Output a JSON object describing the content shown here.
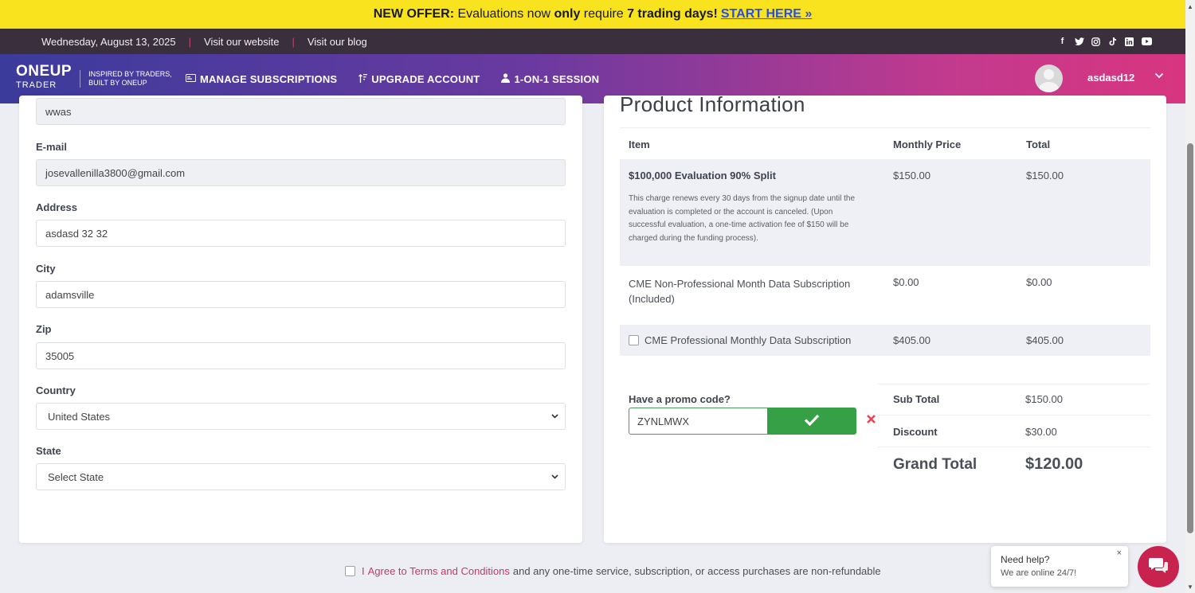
{
  "promo_banner": {
    "offer_label": "NEW OFFER:",
    "text_a": " Evaluations now ",
    "text_only": "only",
    "text_b": " require ",
    "text_days": "7 trading days!",
    "cta": "START HERE »"
  },
  "topbar": {
    "date": "Wednesday, August 13, 2025",
    "links": [
      "Visit our website",
      "Visit our blog"
    ],
    "socials": [
      "facebook-icon",
      "twitter-icon",
      "instagram-icon",
      "tiktok-icon",
      "linkedin-icon",
      "youtube-icon"
    ]
  },
  "nav": {
    "logo_main": "ONEUP",
    "logo_sub": "TRADER",
    "tagline_1": "INSPIRED BY TRADERS,",
    "tagline_2": "BUILT BY ONEUP",
    "items": [
      {
        "label": "MANAGE SUBSCRIPTIONS",
        "icon": "card-icon"
      },
      {
        "label": "UPGRADE ACCOUNT",
        "icon": "upgrade-icon"
      },
      {
        "label": "1-ON-1 SESSION",
        "icon": "session-icon"
      }
    ],
    "username": "asdasd12"
  },
  "form": {
    "name_value": "wwas",
    "email_label": "E-mail",
    "email_value": "josevallenilla3800@gmail.com",
    "address_label": "Address",
    "address_value": "asdasd 32 32",
    "city_label": "City",
    "city_value": "adamsville",
    "zip_label": "Zip",
    "zip_value": "35005",
    "country_label": "Country",
    "country_value": "United States",
    "state_label": "State",
    "state_value": "Select State"
  },
  "product": {
    "title": "Product Information",
    "columns": [
      "Item",
      "Monthly Price",
      "Total"
    ],
    "rows": [
      {
        "item": "$100,000 Evaluation 90% Split",
        "note": "This charge renews every 30 days from the signup date until the evaluation is completed or the account is canceled. (Upon successful evaluation, a one-time activation fee of $150 will be charged during the funding process).",
        "price": "$150.00",
        "total": "$150.00"
      },
      {
        "item": "CME Non-Professional Month Data Subscription (Included)",
        "price": "$0.00",
        "total": "$0.00"
      },
      {
        "item": "CME Professional Monthly Data Subscription",
        "price": "$405.00",
        "total": "$405.00",
        "checked": false
      }
    ],
    "promo_label": "Have a promo code?",
    "promo_value": "ZYNLMWX",
    "sub_total_label": "Sub Total",
    "sub_total_value": "$150.00",
    "discount_label": "Discount",
    "discount_value": "$30.00",
    "grand_total_label": "Grand Total",
    "grand_total_value": "$120.00"
  },
  "agree": {
    "prefix": "I",
    "link": "Agree to Terms and Conditions",
    "suffix": "and any one-time service, subscription, or access purchases are non-refundable"
  },
  "chat": {
    "title": "Need help?",
    "subtitle": "We are online 24/7!",
    "close": "×"
  },
  "colors": {
    "banner": "#f9e21e",
    "accent": "#c23a6e",
    "apply_green": "#36a047"
  }
}
